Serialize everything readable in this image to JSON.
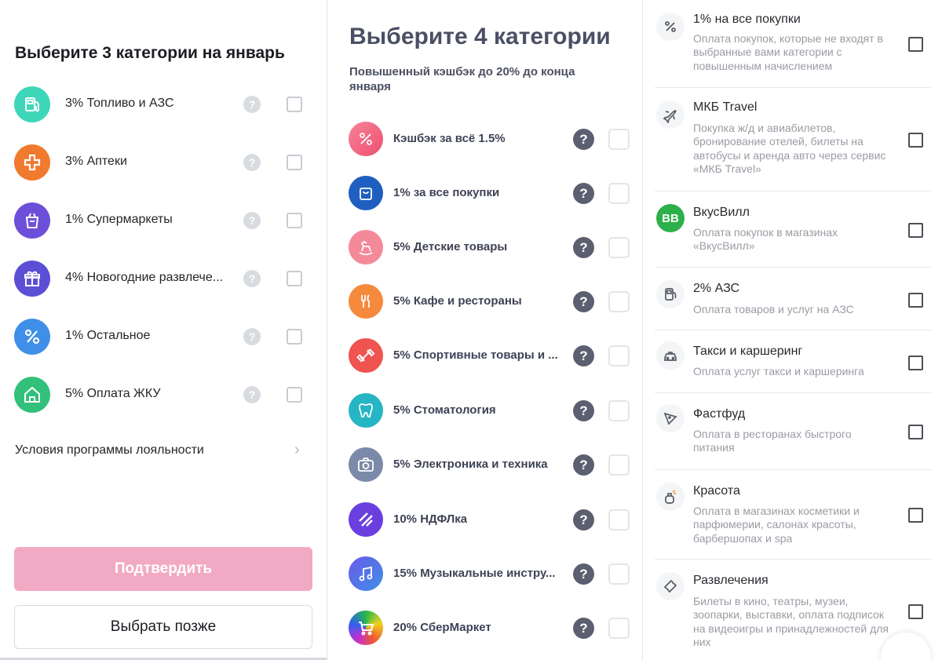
{
  "panel1": {
    "title": "Выберите 3 категории на январь",
    "help_glyph": "?",
    "categories": [
      {
        "label": "3% Топливо и АЗС",
        "icon": "fuel-pump-icon",
        "color": "#3ed6b8"
      },
      {
        "label": "3% Аптеки",
        "icon": "pharmacy-cross-icon",
        "color": "#f07a2e"
      },
      {
        "label": "1% Супермаркеты",
        "icon": "shopping-bag-icon",
        "color": "#6c4fd8"
      },
      {
        "label": "4% Новогодние развлече...",
        "icon": "gift-icon",
        "color": "#5b4fd6"
      },
      {
        "label": "1% Остальное",
        "icon": "percent-icon",
        "color": "#3f8fe8"
      },
      {
        "label": "5% Оплата ЖКУ",
        "icon": "house-icon",
        "color": "#33c07a"
      }
    ],
    "terms_link": "Условия программы лояльности",
    "chevron": "›",
    "confirm_label": "Подтвердить",
    "later_label": "Выбрать позже"
  },
  "panel2": {
    "title": "Выберите 4 категории",
    "subtitle": "Повышенный кэшбэк до 20% до конца января",
    "help_glyph": "?",
    "categories": [
      {
        "label": "Кэшбэк за всё 1.5%",
        "icon": "percent-icon",
        "color": "#f0607a"
      },
      {
        "label": "1% за все покупки",
        "icon": "bag-icon",
        "color": "#1f5fbf"
      },
      {
        "label": "5% Детские товары",
        "icon": "rocking-horse-icon",
        "color": "#f4899a"
      },
      {
        "label": "5% Кафе и рестораны",
        "icon": "fork-knife-icon",
        "color": "#f58a3c"
      },
      {
        "label": "5% Спортивные товары и ...",
        "icon": "dumbbell-icon",
        "color": "#ef5450"
      },
      {
        "label": "5% Стоматология",
        "icon": "tooth-icon",
        "color": "#26b5c3"
      },
      {
        "label": "5% Электроника и техника",
        "icon": "camera-icon",
        "color": "#7a8aa8"
      },
      {
        "label": "10% НДФЛка",
        "icon": "stripes-icon",
        "color": "#6a3fe0"
      },
      {
        "label": "15% Музыкальные инстру...",
        "icon": "music-note-icon",
        "color": "#5a6ae0"
      },
      {
        "label": "20% СберМаркет",
        "icon": "cart-icon",
        "color": "#23b84a"
      }
    ]
  },
  "panel3": {
    "items": [
      {
        "name": "1% на все покупки",
        "desc": "Оплата покупок, которые не входят в выбранные вами категории с повышенным начислением",
        "icon": "percent-icon"
      },
      {
        "name": "МКБ Travel",
        "desc": "Покупка ж/д и авиабилетов, бронирование отелей, билеты на автобусы и аренда авто через сервис «МКБ Travel»",
        "icon": "airplane-icon"
      },
      {
        "name": "ВкусВилл",
        "desc": "Оплата покупок в магазинах «ВкусВилл»",
        "icon": "vkusvill-logo-icon",
        "logo_text": "BB",
        "logo_color": "#2bb04a"
      },
      {
        "name": "2% АЗС",
        "desc": "Оплата товаров и услуг на АЗС",
        "icon": "fuel-pump-icon"
      },
      {
        "name": "Такси и каршеринг",
        "desc": "Оплата услуг такси и каршеринга",
        "icon": "taxi-car-icon"
      },
      {
        "name": "Фастфуд",
        "desc": "Оплата в ресторанах быстрого питания",
        "icon": "pizza-slice-icon"
      },
      {
        "name": "Красота",
        "desc": "Оплата в магазинах косметики и парфюмерии, салонах красоты, барбершопах и spa",
        "icon": "perfume-icon"
      },
      {
        "name": "Развлечения",
        "desc": "Билеты в кино, театры, музеи, зоопарки, выставки, оплата подписок на видеоигры и принадлежностей для них",
        "icon": "ticket-icon"
      }
    ]
  }
}
